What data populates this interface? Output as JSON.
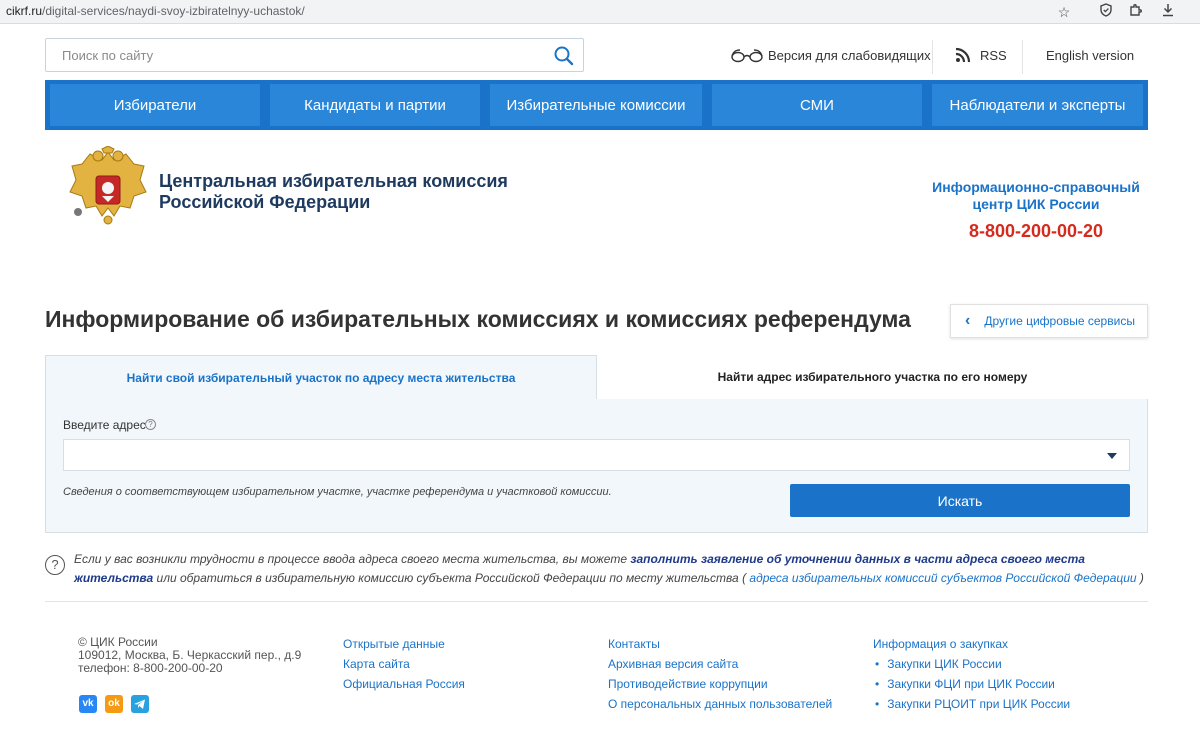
{
  "browser": {
    "url_domain": "cikrf.ru",
    "url_path": "/digital-services/naydi-svoy-izbiratelnyy-uchastok/"
  },
  "topbar": {
    "search_placeholder": "Поиск по сайту",
    "low_vision": "Версия для слабовидящих",
    "rss": "RSS",
    "english": "English version"
  },
  "nav": {
    "items": [
      "Избиратели",
      "Кандидаты и партии",
      "Избирательные комиссии",
      "СМИ",
      "Наблюдатели и эксперты"
    ]
  },
  "header": {
    "org_line1": "Центральная избирательная комиссия",
    "org_line2": "Российской Федерации",
    "info_line1": "Информационно-справочный",
    "info_line2": "центр ЦИК России",
    "phone": "8-800-200-00-20"
  },
  "page": {
    "title": "Информирование об избирательных комиссиях и комиссиях референдума",
    "other_services": "Другие цифровые сервисы"
  },
  "tabs": [
    {
      "label": "Найти свой избирательный участок по адресу места жительства",
      "active": true
    },
    {
      "label": "Найти адрес избирательного участка по его номеру",
      "active": false
    }
  ],
  "form": {
    "address_label": "Введите адрес",
    "address_value": "",
    "hint": "Сведения о соответствующем избирательном участке, участке референдума и участковой комиссии.",
    "find_button": "Искать"
  },
  "help": {
    "text1": "Если у вас возникли трудности в процессе ввода адреса своего места жительства, вы можете ",
    "link1": "заполнить заявление об уточнении данных в части адреса своего места жительства",
    "text2": " или обратиться в избирательную комиссию субъекта Российской Федерации по месту жительства ( ",
    "link2": "адреса избирательных комиссий субъектов Российской Федерации",
    "text3": " )"
  },
  "footer": {
    "copyright": "© ЦИК России",
    "address": "109012, Москва, Б. Черкасский пер., д.9",
    "phone": "телефон: 8-800-200-00-20",
    "col1": [
      "Открытые данные",
      "Карта сайта",
      "Официальная Россия"
    ],
    "col2": [
      "Контакты",
      "Архивная версия сайта",
      "Противодействие коррупции",
      "О персональных данных пользователей"
    ],
    "col3_title": "Информация о закупках",
    "col3": [
      "Закупки ЦИК России",
      "Закупки ФЦИ при ЦИК России",
      "Закупки РЦОИТ при ЦИК России"
    ],
    "social": [
      "vk-icon",
      "odnoklassniki-icon",
      "telegram-icon"
    ]
  },
  "colors": {
    "primary": "#1a73c8",
    "nav_item": "#2a86d8",
    "phone_red": "#d52b1e",
    "panel_bg": "#f2f7fb"
  }
}
